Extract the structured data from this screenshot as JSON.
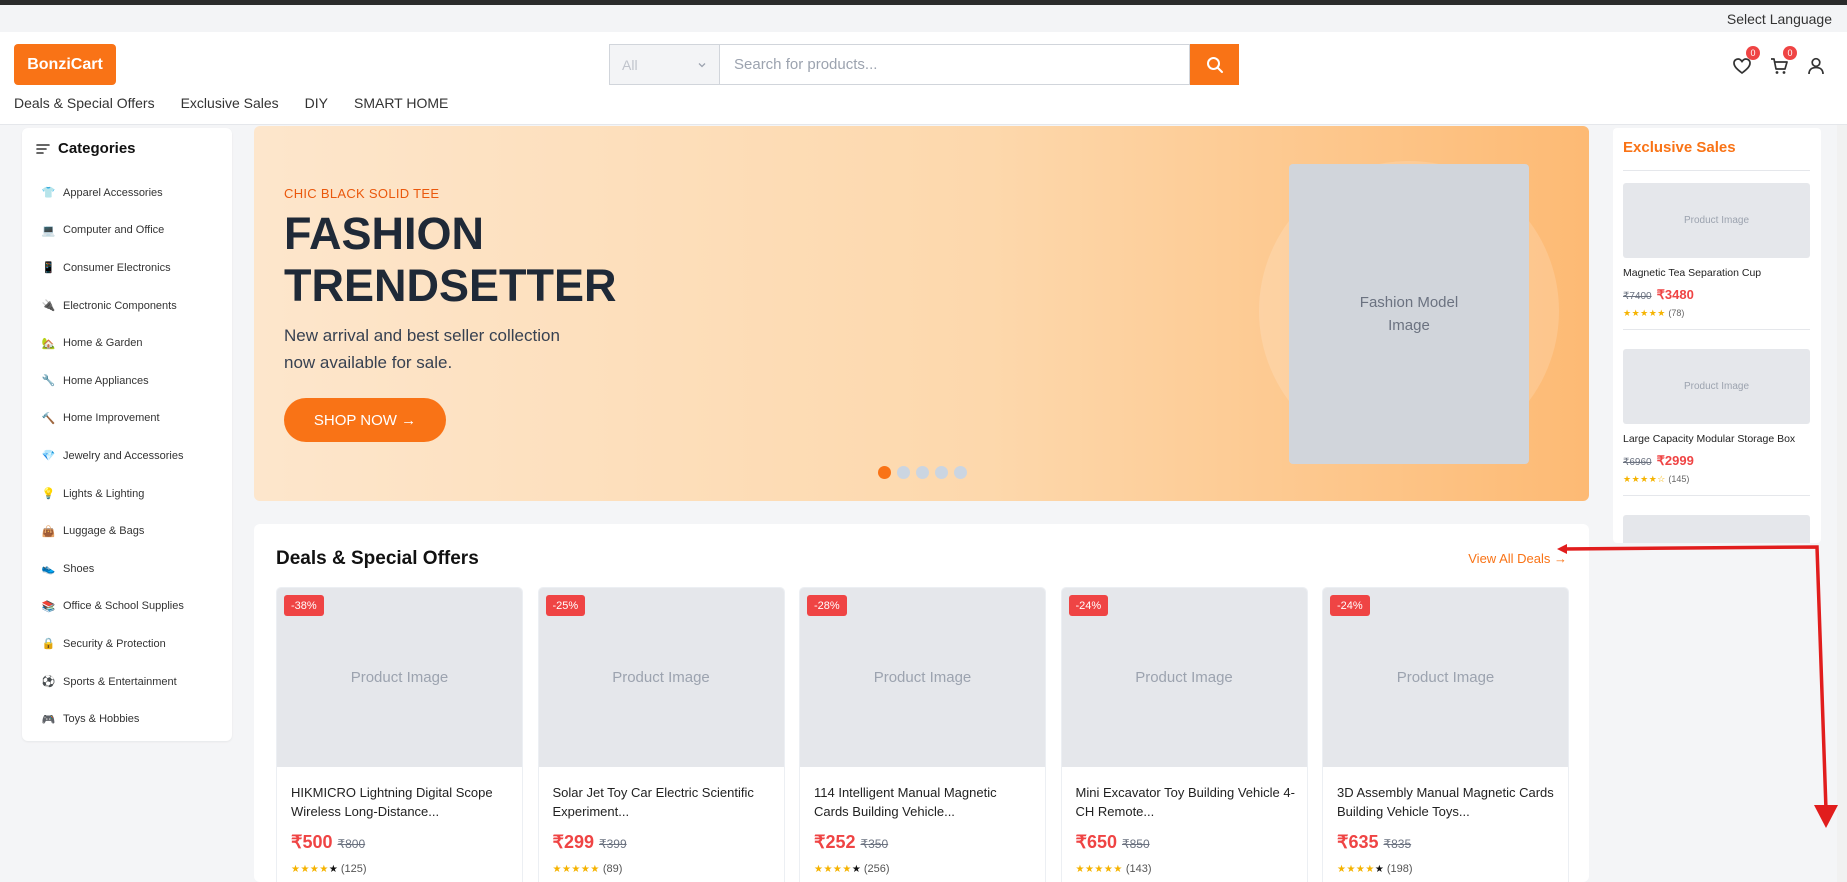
{
  "language": "Select Language",
  "logo": "BonziCart",
  "search": {
    "category": "All",
    "placeholder": "Search for products..."
  },
  "header_icons": {
    "wishlist_count": "0",
    "cart_count": "0"
  },
  "nav": [
    "Deals & Special Offers",
    "Exclusive Sales",
    "DIY",
    "SMART HOME"
  ],
  "sidebar": {
    "title": "Categories",
    "items": [
      {
        "label": "Apparel Accessories",
        "icon": "👕"
      },
      {
        "label": "Computer and Office",
        "icon": "💻"
      },
      {
        "label": "Consumer Electronics",
        "icon": "📱"
      },
      {
        "label": "Electronic Components",
        "icon": "🔌"
      },
      {
        "label": "Home & Garden",
        "icon": "🏡"
      },
      {
        "label": "Home Appliances",
        "icon": "🔧"
      },
      {
        "label": "Home Improvement",
        "icon": "🔨"
      },
      {
        "label": "Jewelry and Accessories",
        "icon": "💎"
      },
      {
        "label": "Lights & Lighting",
        "icon": "💡"
      },
      {
        "label": "Luggage & Bags",
        "icon": "👜"
      },
      {
        "label": "Shoes",
        "icon": "👟"
      },
      {
        "label": "Office & School Supplies",
        "icon": "📚"
      },
      {
        "label": "Security & Protection",
        "icon": "🔒"
      },
      {
        "label": "Sports & Entertainment",
        "icon": "⚽"
      },
      {
        "label": "Toys & Hobbies",
        "icon": "🎮"
      }
    ]
  },
  "hero": {
    "kicker": "CHIC BLACK SOLID TEE",
    "title": "FASHION TRENDSETTER",
    "subtitle": "New arrival and best seller collection now available for sale.",
    "button": "SHOP NOW →",
    "image_label": "Fashion Model Image",
    "slides": 5,
    "active_slide": 1
  },
  "exclusive": {
    "title": "Exclusive Sales",
    "items": [
      {
        "image": "Product Image",
        "name": "Magnetic Tea Separation Cup",
        "was": "₹7400",
        "now": "₹3480",
        "stars": "★★★★★",
        "reviews": "(78)"
      },
      {
        "image": "Product Image",
        "name": "Large Capacity Modular Storage Box",
        "was": "₹6960",
        "now": "₹2999",
        "stars": "★★★★☆",
        "reviews": "(145)"
      }
    ]
  },
  "deals": {
    "title": "Deals & Special Offers",
    "link": "View All Deals →",
    "products": [
      {
        "badge": "-38%",
        "image": "Product Image",
        "name": "HIKMICRO Lightning Digital Scope Wireless Long-Distance...",
        "now": "₹500",
        "was": "₹800",
        "stars": "★★★★",
        "star_empty": "★",
        "reviews": "(125)"
      },
      {
        "badge": "-25%",
        "image": "Product Image",
        "name": "Solar Jet Toy Car Electric Scientific Experiment...",
        "now": "₹299",
        "was": "₹399",
        "stars": "★★★★★",
        "star_empty": "",
        "reviews": "(89)"
      },
      {
        "badge": "-28%",
        "image": "Product Image",
        "name": "114 Intelligent Manual Magnetic Cards Building Vehicle...",
        "now": "₹252",
        "was": "₹350",
        "stars": "★★★★",
        "star_empty": "★",
        "reviews": "(256)"
      },
      {
        "badge": "-24%",
        "image": "Product Image",
        "name": "Mini Excavator Toy Building Vehicle 4-CH Remote...",
        "now": "₹650",
        "was": "₹850",
        "stars": "★★★★★",
        "star_empty": "",
        "reviews": "(143)"
      },
      {
        "badge": "-24%",
        "image": "Product Image",
        "name": "3D Assembly Manual Magnetic Cards Building Vehicle Toys...",
        "now": "₹635",
        "was": "₹835",
        "stars": "★★★★",
        "star_empty": "★",
        "reviews": "(198)"
      }
    ]
  },
  "colors": {
    "accent": "#f97316",
    "sale": "#ef4444",
    "annotation": "#e11d1d"
  }
}
